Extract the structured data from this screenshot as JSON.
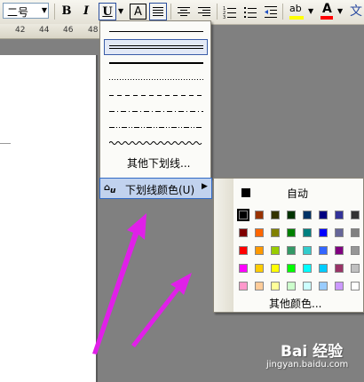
{
  "toolbar": {
    "font_size": "二号",
    "bold": "B",
    "italic": "I",
    "underline": "U",
    "char_border": "A",
    "font_color": "A",
    "phonetic": "文"
  },
  "ruler": {
    "ticks": [
      "42",
      "44",
      "46",
      "48"
    ]
  },
  "underline_menu": {
    "styles": [
      "single",
      "double",
      "thick",
      "dotted",
      "dashed",
      "dash-dot",
      "dash-dot-dot",
      "wave"
    ],
    "selected": "double",
    "more_label": "其他下划线...",
    "color_item_label": "下划线颜色(U)"
  },
  "color_menu": {
    "auto_label": "自动",
    "more_label": "其他颜色...",
    "selected_color": "#000000",
    "rows": [
      [
        "#000000",
        "#993300",
        "#333300",
        "#003300",
        "#003366",
        "#000080",
        "#333399",
        "#333333"
      ],
      [
        "#800000",
        "#FF6600",
        "#808000",
        "#008000",
        "#008080",
        "#0000FF",
        "#666699",
        "#808080"
      ],
      [
        "#FF0000",
        "#FF9900",
        "#99CC00",
        "#339966",
        "#33CCCC",
        "#3366FF",
        "#800080",
        "#969696"
      ],
      [
        "#FF00FF",
        "#FFCC00",
        "#FFFF00",
        "#00FF00",
        "#00FFFF",
        "#00CCFF",
        "#993366",
        "#C0C0C0"
      ],
      [
        "#FF99CC",
        "#FFCC99",
        "#FFFF99",
        "#CCFFCC",
        "#CCFFFF",
        "#99CCFF",
        "#CC99FF",
        "#FFFFFF"
      ]
    ]
  },
  "annotation": {
    "arrow_color": "#E020E8"
  },
  "watermark": {
    "brand": "Bai 经验",
    "url": "jingyan.baidu.com"
  }
}
